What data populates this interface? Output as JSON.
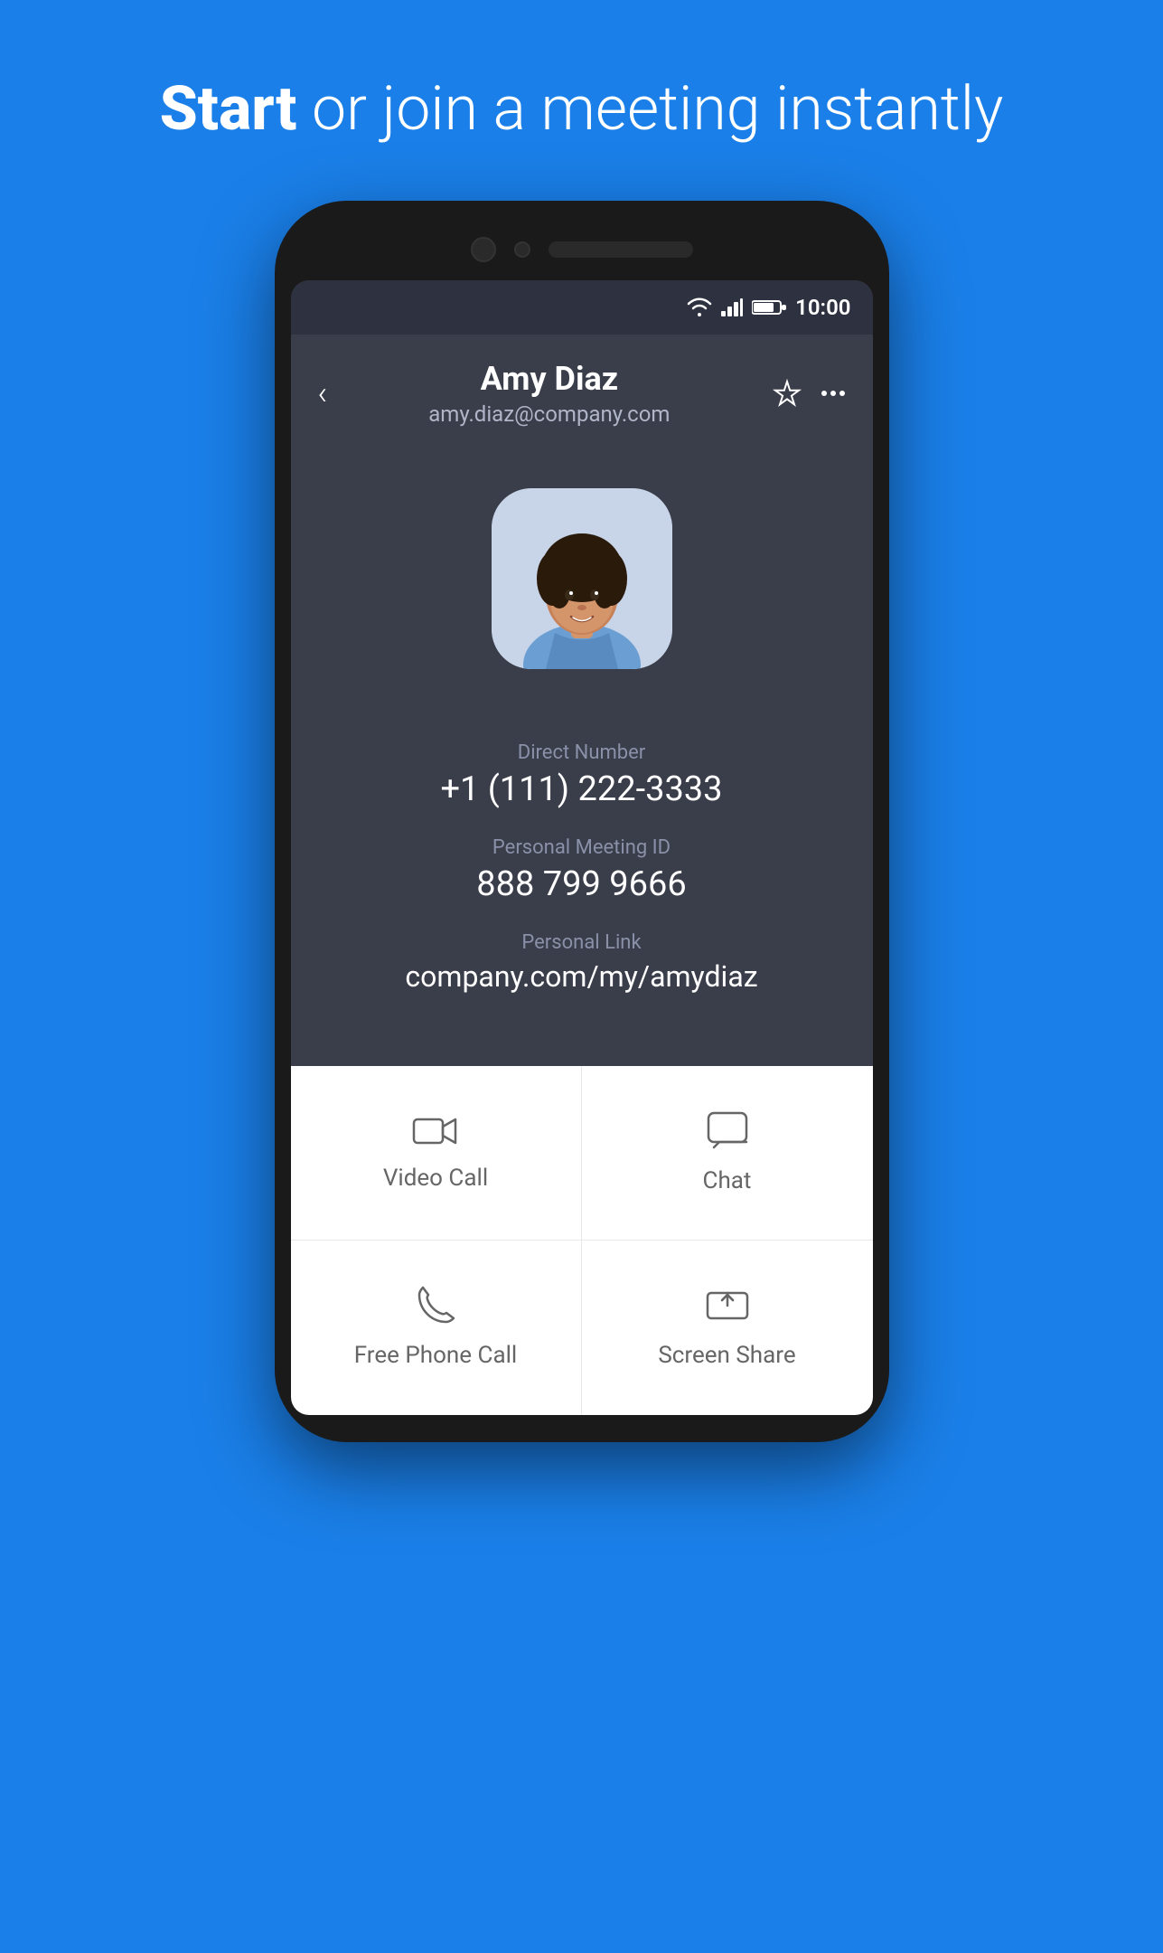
{
  "header": {
    "title_bold": "Start",
    "title_rest": " or join a meeting instantly"
  },
  "status_bar": {
    "time": "10:00"
  },
  "contact": {
    "name": "Amy Diaz",
    "email": "amy.diaz@company.com",
    "direct_number_label": "Direct Number",
    "direct_number": "+1 (111) 222-3333",
    "meeting_id_label": "Personal Meeting ID",
    "meeting_id": "888 799 9666",
    "personal_link_label": "Personal Link",
    "personal_link": "company.com/my/amydiaz"
  },
  "actions": {
    "video_call": "Video Call",
    "chat": "Chat",
    "free_phone_call": "Free Phone Call",
    "screen_share": "Screen Share"
  }
}
